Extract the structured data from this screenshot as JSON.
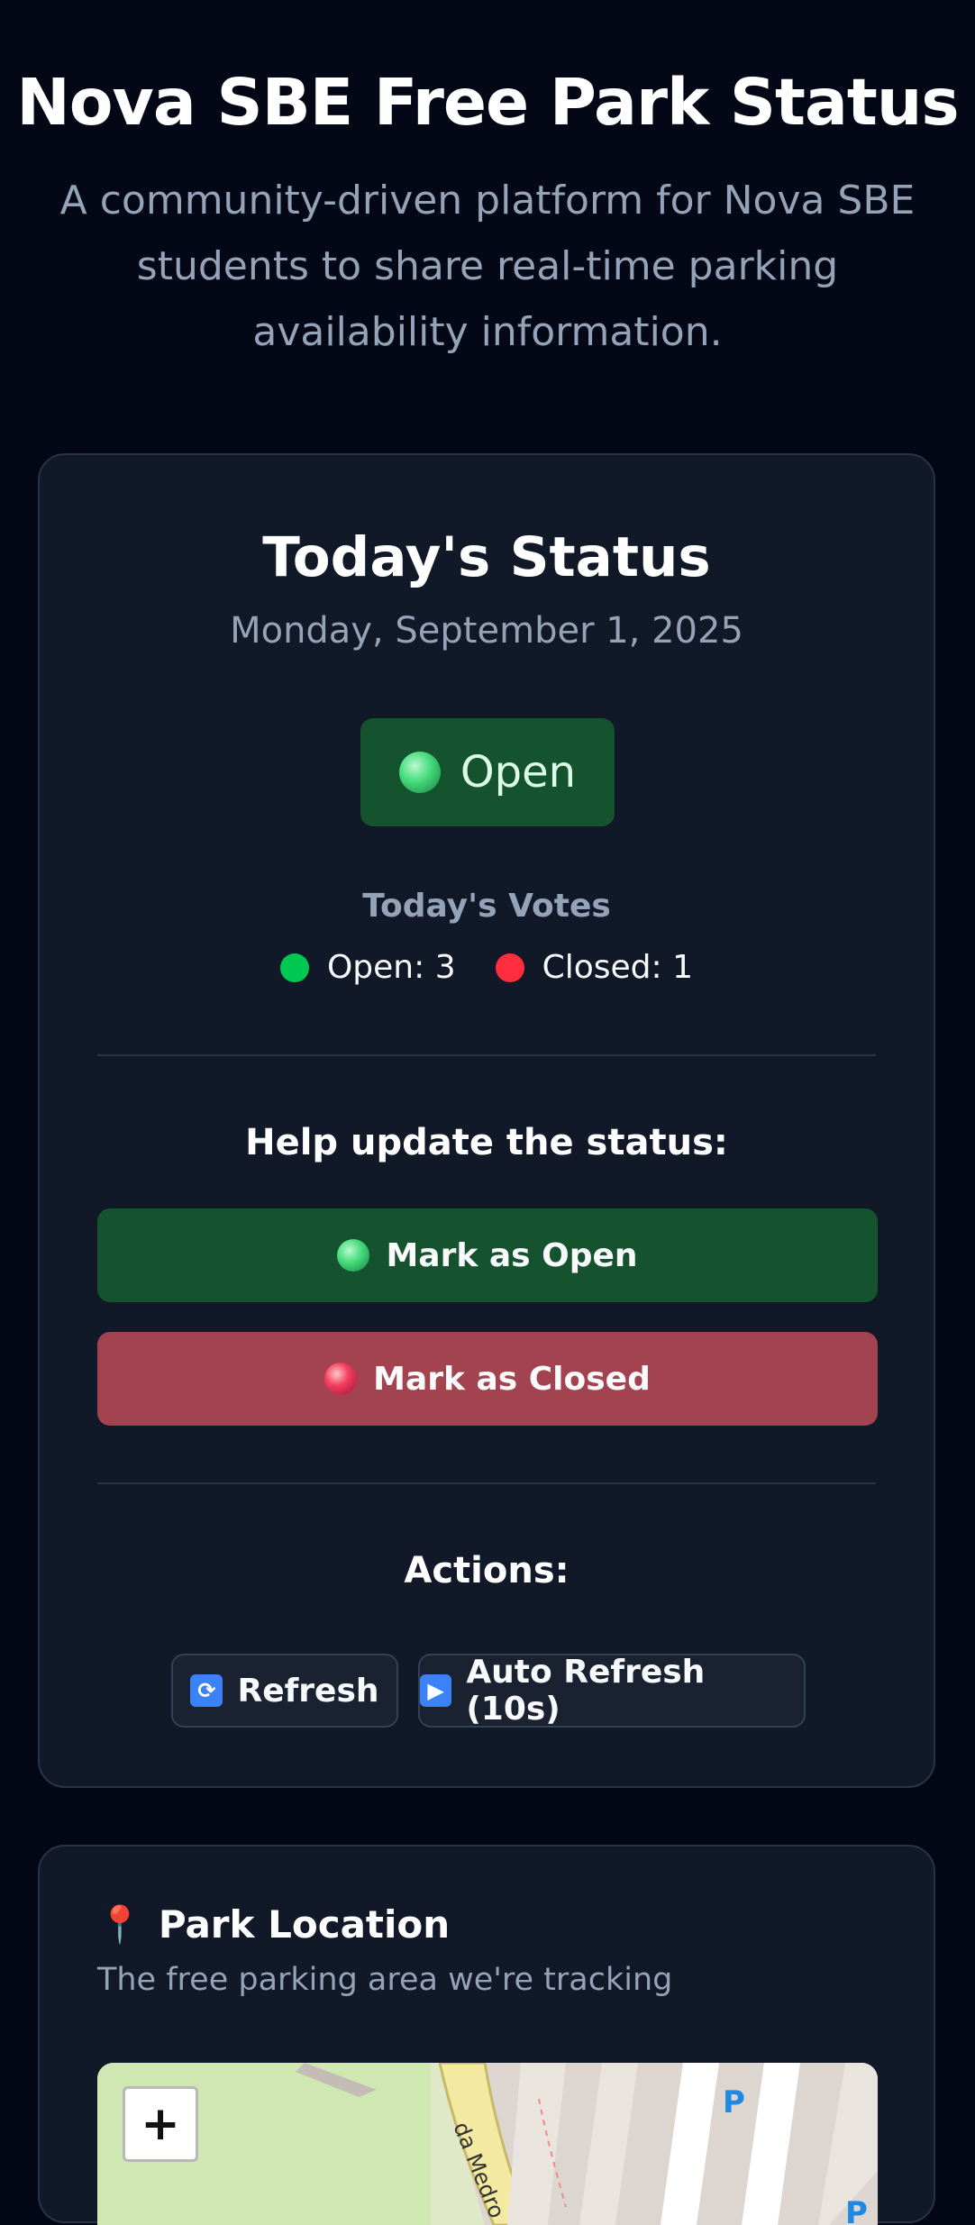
{
  "header": {
    "title": "Nova SBE Free Park Status",
    "subtitle": "A community-driven platform for Nova SBE students to share real-time parking availability information."
  },
  "status_card": {
    "title": "Today's Status",
    "date": "Monday, September 1, 2025",
    "current_status": "Open",
    "votes_label": "Today's Votes",
    "votes": {
      "open_text": "Open: 3",
      "closed_text": "Closed: 1"
    },
    "help_label": "Help update the status:",
    "mark_open_label": "Mark as Open",
    "mark_closed_label": "Mark as Closed",
    "actions_label": "Actions:",
    "refresh_label": "Refresh",
    "auto_refresh_label": "Auto Refresh (10s)"
  },
  "map_card": {
    "title": "Park Location",
    "subtitle": "The free parking area we're tracking",
    "zoom_in_label": "+",
    "street_label": "da Medro",
    "parking_marker": "P"
  },
  "colors": {
    "background": "#040816",
    "card": "#111827",
    "open_green": "#14532d",
    "closed_red": "#a3434f",
    "vote_green_dot": "#00c853",
    "vote_red_dot": "#ff2d3d"
  },
  "icons": {
    "status_orb": "green-orb-icon",
    "refresh": "refresh-arrows-icon",
    "auto_refresh": "play-icon",
    "location": "round-pushpin-icon"
  }
}
